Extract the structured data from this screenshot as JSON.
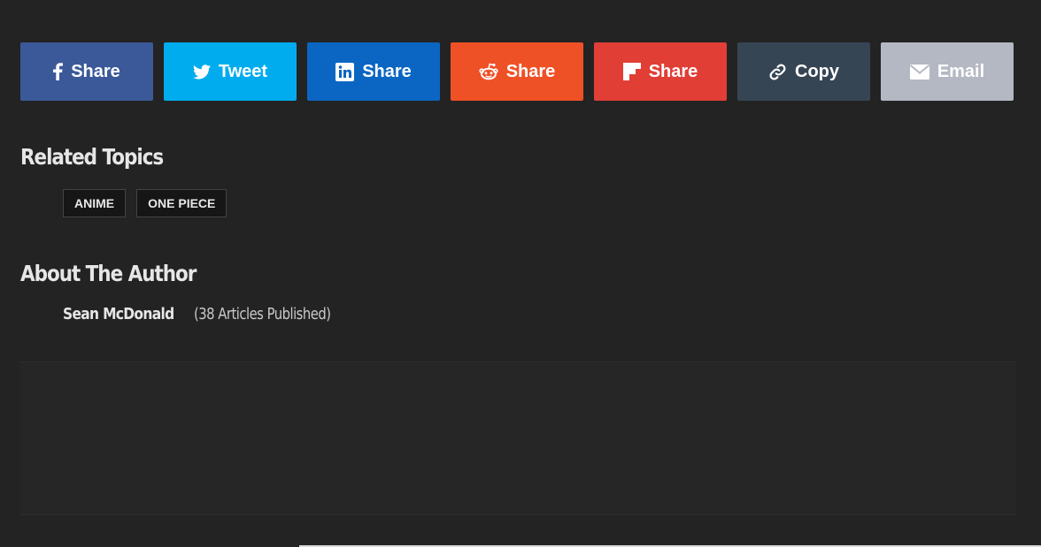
{
  "share_buttons": [
    {
      "label": "Share",
      "icon": "facebook-icon",
      "color": "#3b5998"
    },
    {
      "label": "Tweet",
      "icon": "twitter-icon",
      "color": "#00acee"
    },
    {
      "label": "Share",
      "icon": "linkedin-icon",
      "color": "#0a66c2"
    },
    {
      "label": "Share",
      "icon": "reddit-icon",
      "color": "#ef5126"
    },
    {
      "label": "Share",
      "icon": "flipboard-icon",
      "color": "#e13e36"
    },
    {
      "label": "Copy",
      "icon": "link-icon",
      "color": "#364554"
    },
    {
      "label": "Email",
      "icon": "envelope-icon",
      "color": "#b3b8c3"
    }
  ],
  "related_topics": {
    "heading": "Related Topics",
    "tags": [
      "ANIME",
      "ONE PIECE"
    ]
  },
  "about_author": {
    "heading": "About The Author",
    "name": "Sean McDonald",
    "articles": "(38 Articles Published)"
  },
  "colors": {
    "page_background": "#232323",
    "heading_text": "#e6e6e6",
    "tag_background": "#161616"
  }
}
